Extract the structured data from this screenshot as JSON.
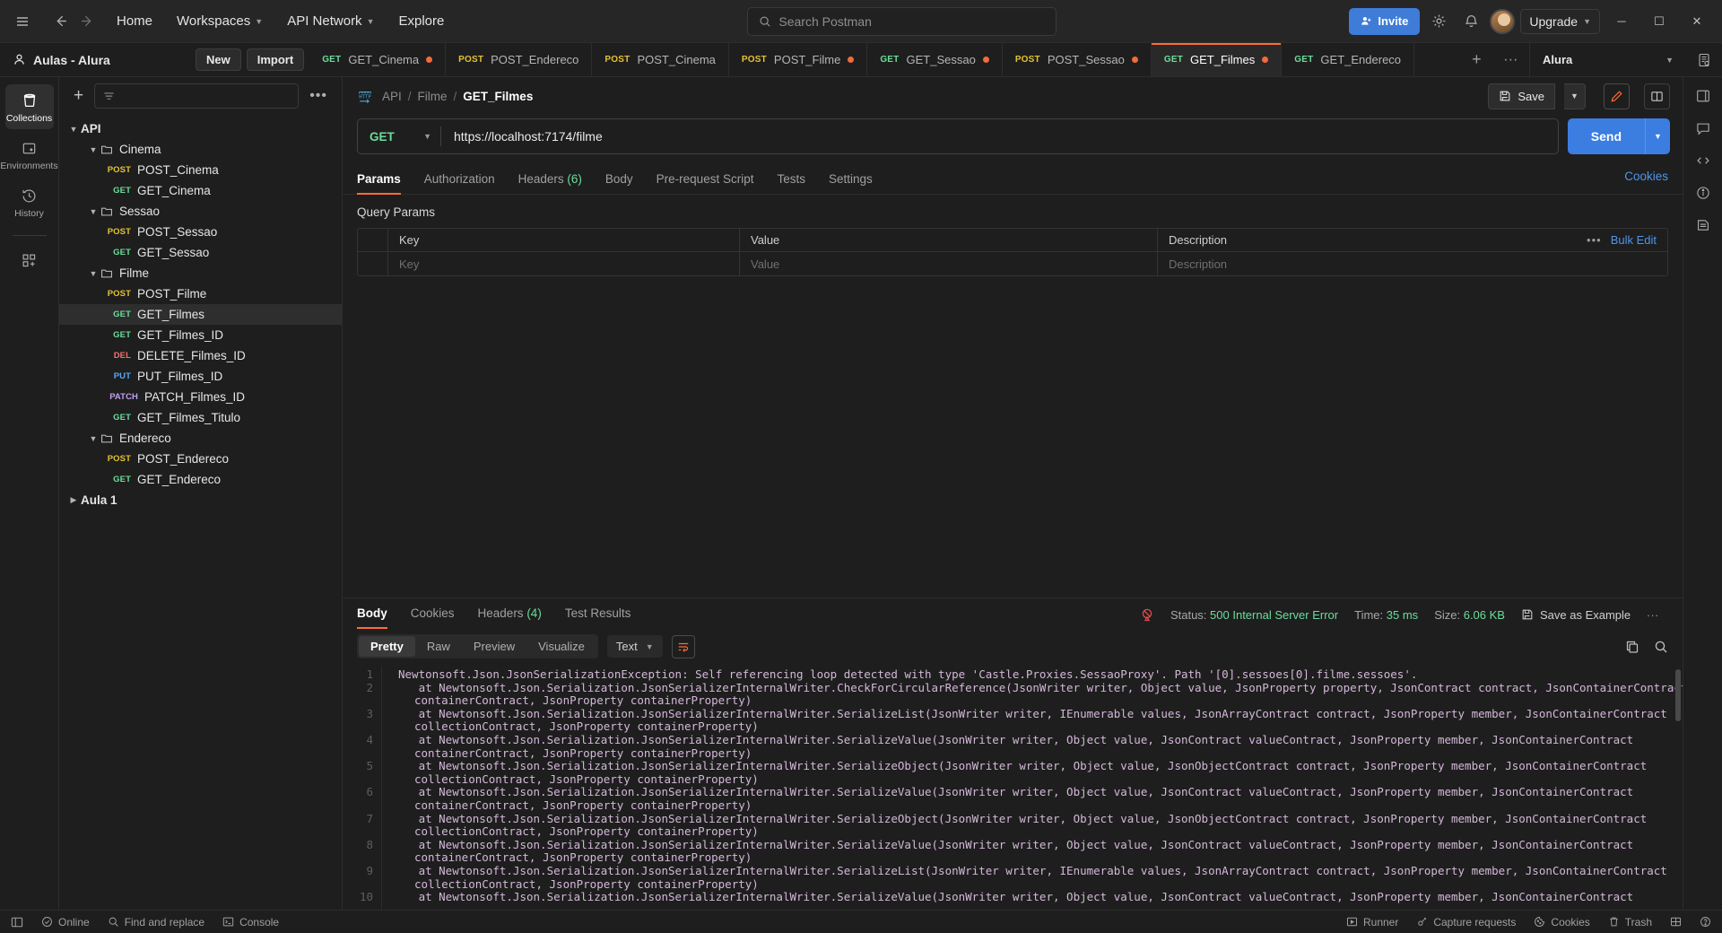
{
  "topbar": {
    "hamburger_icon": "hamburger-icon",
    "back_icon": "arrow-left-icon",
    "forward_icon": "arrow-right-icon",
    "home": "Home",
    "workspaces": "Workspaces",
    "api_network": "API Network",
    "explore": "Explore",
    "search_placeholder": "Search Postman",
    "invite": "Invite",
    "settings_icon": "gear-icon",
    "notifications_icon": "bell-icon",
    "upgrade": "Upgrade",
    "minimize": "─",
    "maximize": "☐",
    "close": "✕"
  },
  "tabbar": {
    "workspace_name": "Aulas - Alura",
    "new_label": "New",
    "import_label": "Import",
    "tabs": [
      {
        "method": "GET",
        "name": "GET_Cinema",
        "dirty": true,
        "active": false
      },
      {
        "method": "POST",
        "name": "POST_Endereco",
        "dirty": false,
        "active": false
      },
      {
        "method": "POST",
        "name": "POST_Cinema",
        "dirty": false,
        "active": false
      },
      {
        "method": "POST",
        "name": "POST_Filme",
        "dirty": true,
        "active": false
      },
      {
        "method": "GET",
        "name": "GET_Sessao",
        "dirty": true,
        "active": false
      },
      {
        "method": "POST",
        "name": "POST_Sessao",
        "dirty": true,
        "active": false
      },
      {
        "method": "GET",
        "name": "GET_Filmes",
        "dirty": true,
        "active": true
      },
      {
        "method": "GET",
        "name": "GET_Endereco",
        "dirty": false,
        "active": false
      }
    ],
    "add_tab": "+",
    "more": "∙∙∙",
    "environment": "Alura"
  },
  "rail": {
    "items": [
      {
        "label": "Collections",
        "icon": "collections-icon",
        "active": true
      },
      {
        "label": "Environments",
        "icon": "environments-icon",
        "active": false
      },
      {
        "label": "History",
        "icon": "history-icon",
        "active": false
      }
    ],
    "add_more_icon": "add-modules-icon"
  },
  "sidebar": {
    "new_icon": "plus-icon",
    "filter_icon": "filter-icon",
    "more_icon": "more-horizontal-icon",
    "tree": [
      {
        "kind": "collection",
        "label": "API",
        "depth": 0,
        "expanded": true
      },
      {
        "kind": "folder",
        "label": "Cinema",
        "depth": 1,
        "expanded": true
      },
      {
        "kind": "request",
        "method": "POST",
        "label": "POST_Cinema",
        "depth": 2
      },
      {
        "kind": "request",
        "method": "GET",
        "label": "GET_Cinema",
        "depth": 2
      },
      {
        "kind": "folder",
        "label": "Sessao",
        "depth": 1,
        "expanded": true
      },
      {
        "kind": "request",
        "method": "POST",
        "label": "POST_Sessao",
        "depth": 2
      },
      {
        "kind": "request",
        "method": "GET",
        "label": "GET_Sessao",
        "depth": 2
      },
      {
        "kind": "folder",
        "label": "Filme",
        "depth": 1,
        "expanded": true
      },
      {
        "kind": "request",
        "method": "POST",
        "label": "POST_Filme",
        "depth": 2
      },
      {
        "kind": "request",
        "method": "GET",
        "label": "GET_Filmes",
        "depth": 2,
        "selected": true
      },
      {
        "kind": "request",
        "method": "GET",
        "label": "GET_Filmes_ID",
        "depth": 2
      },
      {
        "kind": "request",
        "method": "DEL",
        "label": "DELETE_Filmes_ID",
        "depth": 2
      },
      {
        "kind": "request",
        "method": "PUT",
        "label": "PUT_Filmes_ID",
        "depth": 2
      },
      {
        "kind": "request",
        "method": "PATCH",
        "label": "PATCH_Filmes_ID",
        "depth": 2
      },
      {
        "kind": "request",
        "method": "GET",
        "label": "GET_Filmes_Titulo",
        "depth": 2
      },
      {
        "kind": "folder",
        "label": "Endereco",
        "depth": 1,
        "expanded": true
      },
      {
        "kind": "request",
        "method": "POST",
        "label": "POST_Endereco",
        "depth": 2
      },
      {
        "kind": "request",
        "method": "GET",
        "label": "GET_Endereco",
        "depth": 2
      },
      {
        "kind": "collection",
        "label": "Aula 1",
        "depth": 0,
        "expanded": false
      }
    ]
  },
  "request": {
    "breadcrumb": {
      "root": "API",
      "folder": "Filme",
      "current": "GET_Filmes",
      "sep": "/"
    },
    "protocol_icon": "http-icon",
    "save_label": "Save",
    "method": "GET",
    "url": "https://localhost:7174/filme",
    "send_label": "Send",
    "tabs": [
      {
        "label": "Params",
        "count": "",
        "active": true
      },
      {
        "label": "Authorization",
        "count": "",
        "active": false
      },
      {
        "label": "Headers",
        "count": "(6)",
        "active": false
      },
      {
        "label": "Body",
        "count": "",
        "active": false
      },
      {
        "label": "Pre-request Script",
        "count": "",
        "active": false
      },
      {
        "label": "Tests",
        "count": "",
        "active": false
      },
      {
        "label": "Settings",
        "count": "",
        "active": false
      }
    ],
    "cookies_link": "Cookies",
    "query_params_title": "Query Params",
    "table_headers": [
      "Key",
      "Value",
      "Description"
    ],
    "table_placeholders": [
      "Key",
      "Value",
      "Description"
    ],
    "bulk_edit": "Bulk Edit"
  },
  "response": {
    "tabs": [
      {
        "label": "Body",
        "count": "",
        "active": true
      },
      {
        "label": "Cookies",
        "count": "",
        "active": false
      },
      {
        "label": "Headers",
        "count": "(4)",
        "active": false
      },
      {
        "label": "Test Results",
        "count": "",
        "active": false
      }
    ],
    "status_label": "Status:",
    "status_value": "500 Internal Server Error",
    "time_label": "Time:",
    "time_value": "35 ms",
    "size_label": "Size:",
    "size_value": "6.06 KB",
    "save_as_example": "Save as Example",
    "more": "∙∙∙",
    "view_modes": [
      "Pretty",
      "Raw",
      "Preview",
      "Visualize"
    ],
    "active_view": "Pretty",
    "format": "Text",
    "wrap_icon": "word-wrap-icon",
    "copy_icon": "copy-icon",
    "search_icon": "search-icon",
    "body_lines": [
      {
        "n": "1",
        "segments": [
          "Newtonsoft.Json.JsonSerializationException: Self referencing loop detected with type 'Castle.Proxies.SessaoProxy'. Path '[0].sessoes[0].filme.sessoes'."
        ]
      },
      {
        "n": "2",
        "segments": [
          "   at Newtonsoft.Json.Serialization.JsonSerializerInternalWriter.CheckForCircularReference(JsonWriter writer, Object value, JsonProperty property, JsonContract contract, JsonContainerContract",
          "containerContract, JsonProperty containerProperty)"
        ]
      },
      {
        "n": "3",
        "segments": [
          "   at Newtonsoft.Json.Serialization.JsonSerializerInternalWriter.SerializeList(JsonWriter writer, IEnumerable values, JsonArrayContract contract, JsonProperty member, JsonContainerContract",
          "collectionContract, JsonProperty containerProperty)"
        ]
      },
      {
        "n": "4",
        "segments": [
          "   at Newtonsoft.Json.Serialization.JsonSerializerInternalWriter.SerializeValue(JsonWriter writer, Object value, JsonContract valueContract, JsonProperty member, JsonContainerContract",
          "containerContract, JsonProperty containerProperty)"
        ]
      },
      {
        "n": "5",
        "segments": [
          "   at Newtonsoft.Json.Serialization.JsonSerializerInternalWriter.SerializeObject(JsonWriter writer, Object value, JsonObjectContract contract, JsonProperty member, JsonContainerContract",
          "collectionContract, JsonProperty containerProperty)"
        ]
      },
      {
        "n": "6",
        "segments": [
          "   at Newtonsoft.Json.Serialization.JsonSerializerInternalWriter.SerializeValue(JsonWriter writer, Object value, JsonContract valueContract, JsonProperty member, JsonContainerContract",
          "containerContract, JsonProperty containerProperty)"
        ]
      },
      {
        "n": "7",
        "segments": [
          "   at Newtonsoft.Json.Serialization.JsonSerializerInternalWriter.SerializeObject(JsonWriter writer, Object value, JsonObjectContract contract, JsonProperty member, JsonContainerContract",
          "collectionContract, JsonProperty containerProperty)"
        ]
      },
      {
        "n": "8",
        "segments": [
          "   at Newtonsoft.Json.Serialization.JsonSerializerInternalWriter.SerializeValue(JsonWriter writer, Object value, JsonContract valueContract, JsonProperty member, JsonContainerContract",
          "containerContract, JsonProperty containerProperty)"
        ]
      },
      {
        "n": "9",
        "segments": [
          "   at Newtonsoft.Json.Serialization.JsonSerializerInternalWriter.SerializeList(JsonWriter writer, IEnumerable values, JsonArrayContract contract, JsonProperty member, JsonContainerContract",
          "collectionContract, JsonProperty containerProperty)"
        ]
      },
      {
        "n": "10",
        "segments": [
          "   at Newtonsoft.Json.Serialization.JsonSerializerInternalWriter.SerializeValue(JsonWriter writer, Object value, JsonContract valueContract, JsonProperty member, JsonContainerContract"
        ]
      }
    ]
  },
  "statusbar": {
    "left": [
      {
        "label": "",
        "icon": "sidebar-toggle-icon"
      },
      {
        "label": "Online",
        "icon": "online-icon"
      },
      {
        "label": "Find and replace",
        "icon": "search-icon"
      },
      {
        "label": "Console",
        "icon": "console-icon"
      }
    ],
    "right": [
      {
        "label": "Runner",
        "icon": "runner-icon"
      },
      {
        "label": "Capture requests",
        "icon": "capture-icon"
      },
      {
        "label": "Cookies",
        "icon": "cookie-icon"
      },
      {
        "label": "Trash",
        "icon": "trash-icon"
      },
      {
        "label": "",
        "icon": "layout-icon"
      },
      {
        "label": "",
        "icon": "help-icon"
      }
    ]
  },
  "right_rail": {
    "icons": [
      "panel-icon",
      "comment-icon",
      "code-icon",
      "info-circle-icon",
      "documentation-icon"
    ]
  },
  "colors": {
    "accent": "#ff6c37",
    "send": "#3b7de0",
    "get": "#6bdd9a",
    "post": "#e3c233",
    "delete": "#f4736c",
    "put": "#5aa7f5",
    "patch": "#c39ff0",
    "error": "#e04b4b",
    "link": "#4f95ec"
  }
}
